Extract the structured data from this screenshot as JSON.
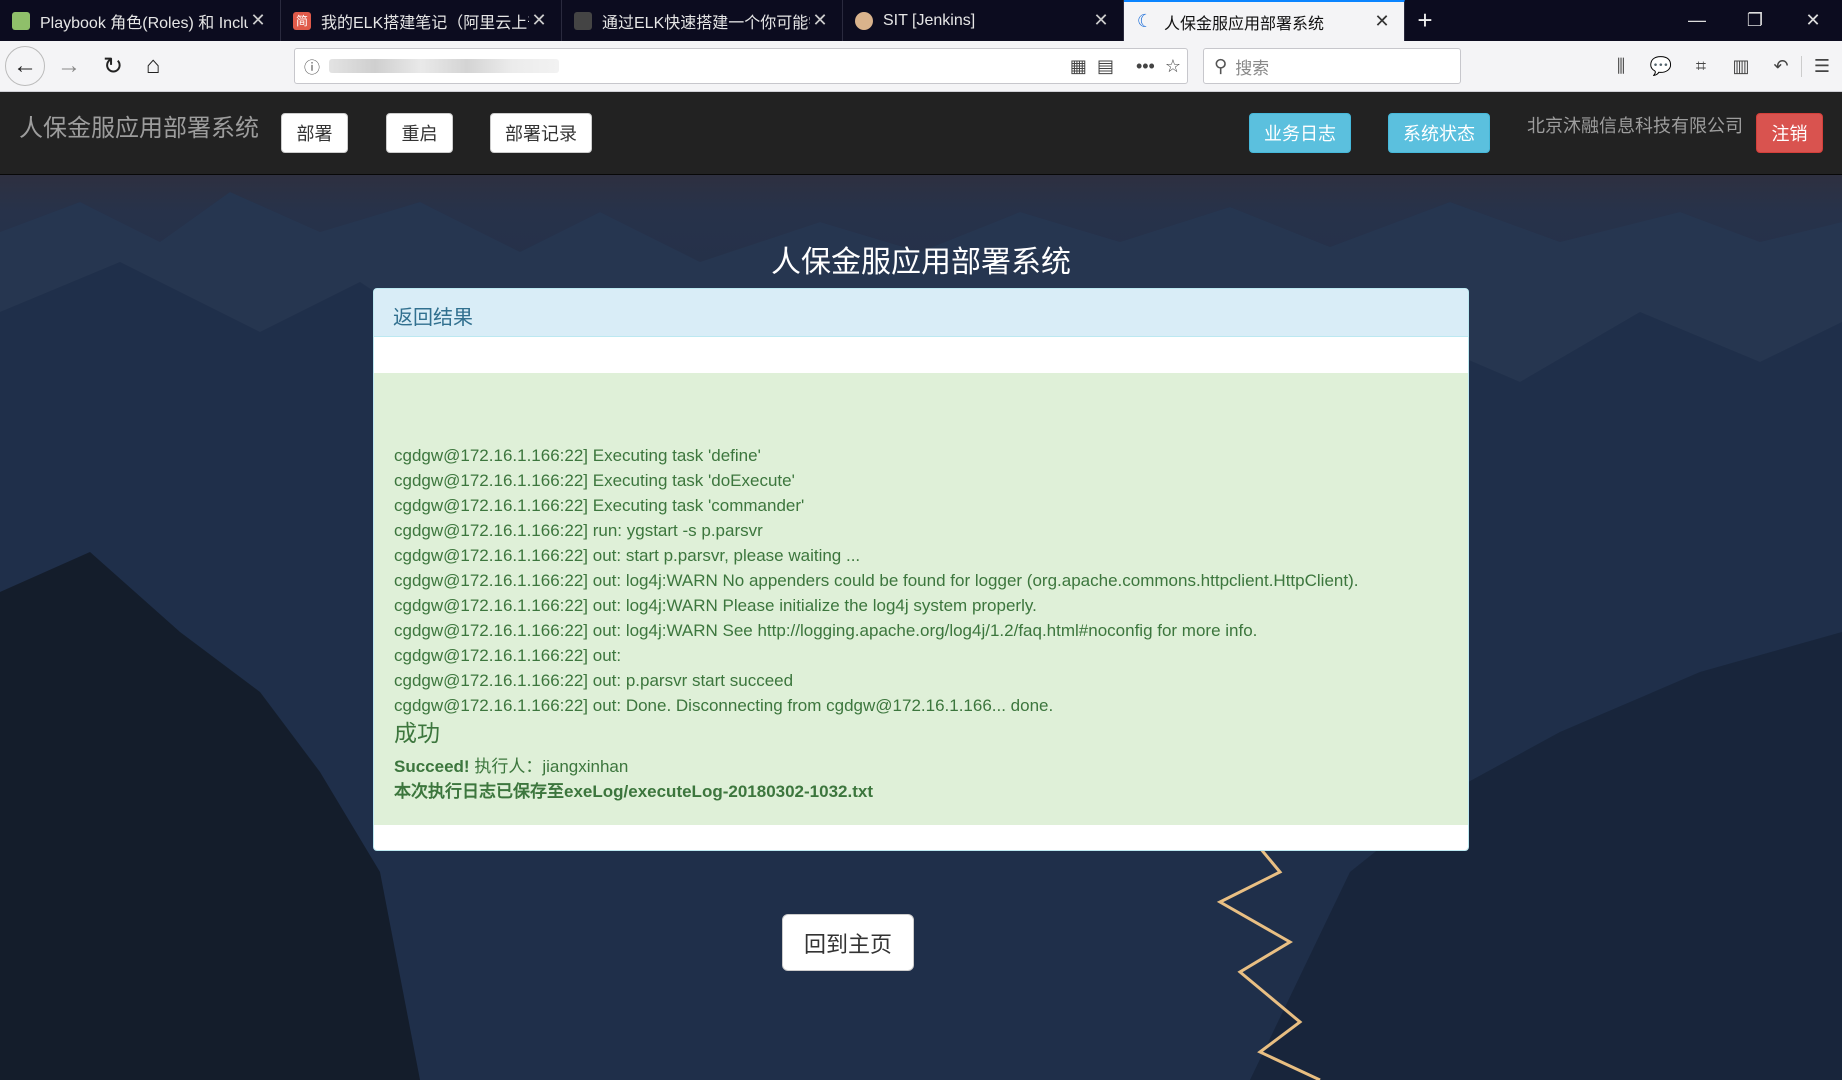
{
  "browser": {
    "tabs": [
      {
        "title": "Playbook 角色(Roles) 和 Inclu",
        "favicon_color": "#8fbf6a",
        "favicon_glyph": "",
        "active": false
      },
      {
        "title": "我的ELK搭建笔记（阿里云上部",
        "favicon_color": "#e05a4a",
        "favicon_glyph": "简",
        "active": false
      },
      {
        "title": "通过ELK快速搭建一个你可能需",
        "favicon_color": "#444444",
        "favicon_glyph": "",
        "active": false
      },
      {
        "title": "SIT [Jenkins]",
        "favicon_color": "#d9b38c",
        "favicon_glyph": "",
        "active": false
      },
      {
        "title": "人保金服应用部署系统",
        "favicon_color": "#1e6fd9",
        "favicon_glyph": "",
        "active": true
      }
    ],
    "search_placeholder": "搜索"
  },
  "app": {
    "brand": "人保金服应用部署系统",
    "nav": {
      "deploy": "部署",
      "restart": "重启",
      "deploy_records": "部署记录",
      "business_log": "业务日志",
      "system_status": "系统状态",
      "company": "北京沐融信息科技有限公司",
      "logout": "注销"
    },
    "page_title": "人保金服应用部署系统",
    "panel": {
      "heading": "返回结果",
      "log_lines": [
        "cgdgw@172.16.1.166:22] Executing task 'define'",
        "cgdgw@172.16.1.166:22] Executing task 'doExecute'",
        "cgdgw@172.16.1.166:22] Executing task 'commander'",
        "cgdgw@172.16.1.166:22] run: ygstart -s p.parsvr",
        "cgdgw@172.16.1.166:22] out: start p.parsvr, please waiting ...",
        "cgdgw@172.16.1.166:22] out: log4j:WARN No appenders could be found for logger (org.apache.commons.httpclient.HttpClient).",
        "cgdgw@172.16.1.166:22] out: log4j:WARN Please initialize the log4j system properly.",
        "cgdgw@172.16.1.166:22] out: log4j:WARN See http://logging.apache.org/log4j/1.2/faq.html#noconfig for more info.",
        "cgdgw@172.16.1.166:22] out:",
        "cgdgw@172.16.1.166:22] out: p.parsvr start succeed",
        "cgdgw@172.16.1.166:22] out: Done. Disconnecting from cgdgw@172.16.1.166... done."
      ],
      "result_title": "成功",
      "succeed_label": "Succeed!",
      "executor_text": " 执行人：jiangxinhan",
      "saved_log_text": "本次执行日志已保存至exeLog/executeLog-20180302-1032.txt"
    },
    "home_button": "回到主页"
  },
  "colors": {
    "navbar_bg": "#222222",
    "info_btn": "#5bc0de",
    "danger_btn": "#d9534f",
    "panel_heading_bg": "#d9edf7",
    "alert_success_bg": "#dff0d8",
    "alert_success_text": "#3c763d"
  }
}
